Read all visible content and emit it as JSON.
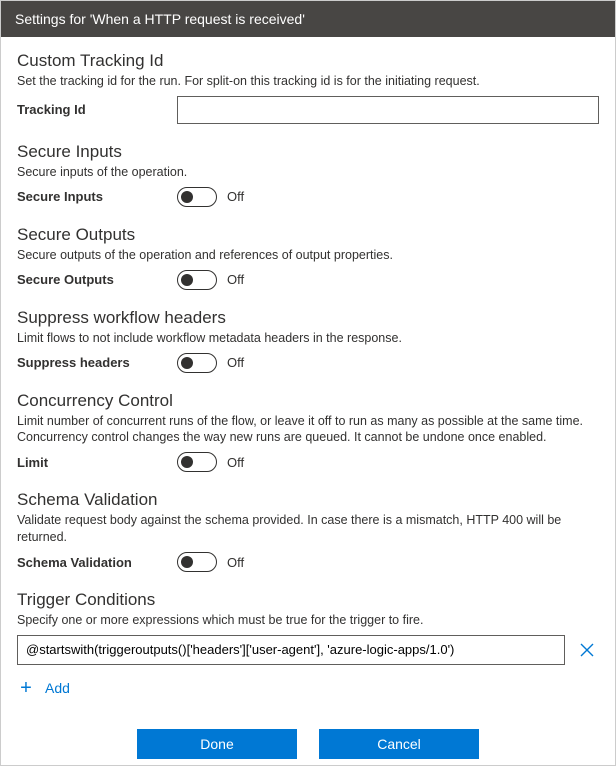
{
  "title": "Settings for 'When a HTTP request is received'",
  "tracking": {
    "heading": "Custom Tracking Id",
    "desc": "Set the tracking id for the run. For split-on this tracking id is for the initiating request.",
    "label": "Tracking Id",
    "value": ""
  },
  "secure_inputs": {
    "heading": "Secure Inputs",
    "desc": "Secure inputs of the operation.",
    "label": "Secure Inputs",
    "state": "Off"
  },
  "secure_outputs": {
    "heading": "Secure Outputs",
    "desc": "Secure outputs of the operation and references of output properties.",
    "label": "Secure Outputs",
    "state": "Off"
  },
  "suppress_headers": {
    "heading": "Suppress workflow headers",
    "desc": "Limit flows to not include workflow metadata headers in the response.",
    "label": "Suppress headers",
    "state": "Off"
  },
  "concurrency": {
    "heading": "Concurrency Control",
    "desc": "Limit number of concurrent runs of the flow, or leave it off to run as many as possible at the same time. Concurrency control changes the way new runs are queued. It cannot be undone once enabled.",
    "label": "Limit",
    "state": "Off"
  },
  "schema_validation": {
    "heading": "Schema Validation",
    "desc": "Validate request body against the schema provided. In case there is a mismatch, HTTP 400 will be returned.",
    "label": "Schema Validation",
    "state": "Off"
  },
  "trigger_conditions": {
    "heading": "Trigger Conditions",
    "desc": "Specify one or more expressions which must be true for the trigger to fire.",
    "value": "@startswith(triggeroutputs()['headers']['user-agent'], 'azure-logic-apps/1.0')",
    "add_label": "Add"
  },
  "footer": {
    "done": "Done",
    "cancel": "Cancel"
  }
}
